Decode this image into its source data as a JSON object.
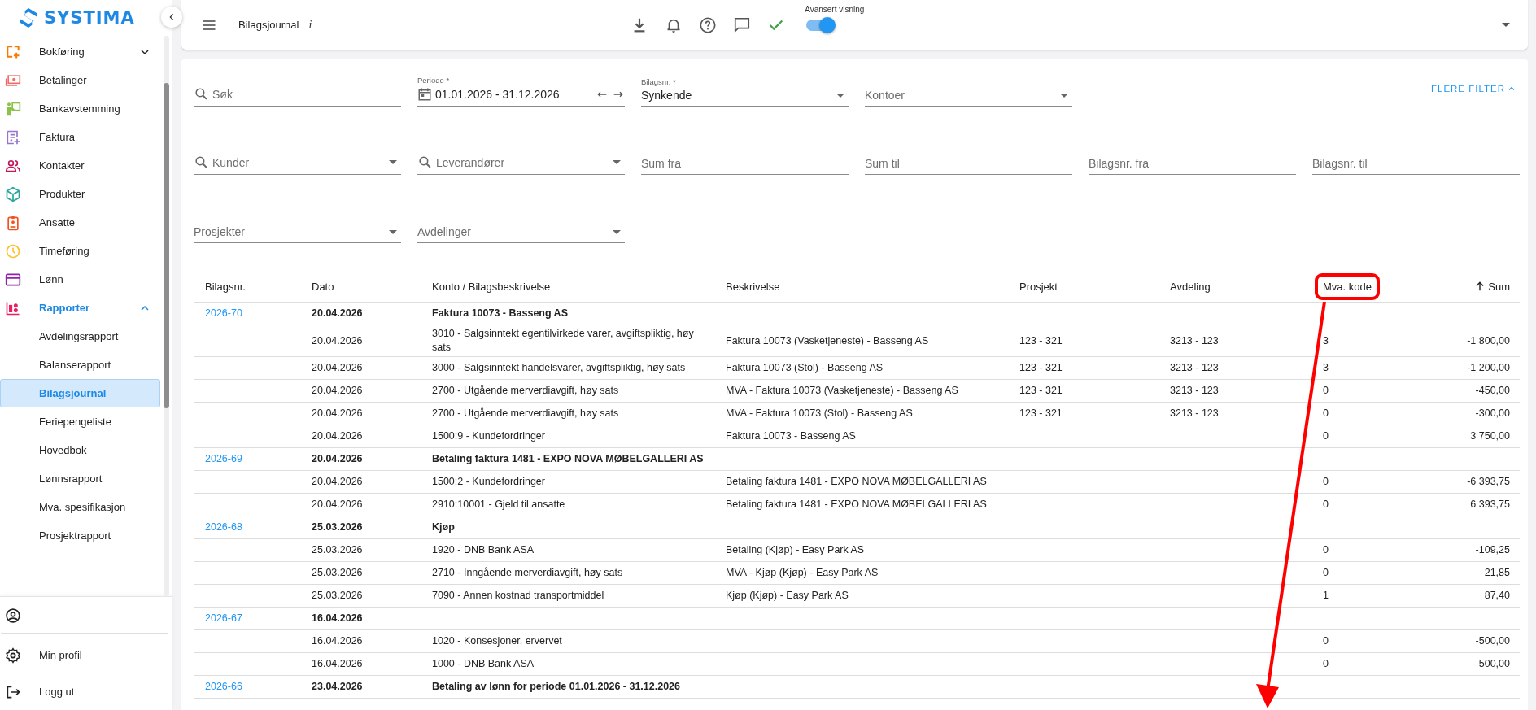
{
  "brand": {
    "name": "SYSTIMA"
  },
  "sidebar": {
    "items": [
      {
        "label": "Bokføring",
        "expanded": false
      },
      {
        "label": "Betalinger"
      },
      {
        "label": "Bankavstemming"
      },
      {
        "label": "Faktura"
      },
      {
        "label": "Kontakter"
      },
      {
        "label": "Produkter"
      },
      {
        "label": "Ansatte"
      },
      {
        "label": "Timeføring"
      },
      {
        "label": "Lønn"
      },
      {
        "label": "Rapporter",
        "expanded": true,
        "children": [
          {
            "label": "Avdelingsrapport",
            "selected": false
          },
          {
            "label": "Balanserapport",
            "selected": false
          },
          {
            "label": "Bilagsjournal",
            "selected": true
          },
          {
            "label": "Feriepengeliste",
            "selected": false
          },
          {
            "label": "Hovedbok",
            "selected": false
          },
          {
            "label": "Lønnsrapport",
            "selected": false
          },
          {
            "label": "Mva. spesifikasjon",
            "selected": false
          },
          {
            "label": "Prosjektrapport",
            "selected": false
          }
        ]
      }
    ],
    "footer": [
      {
        "kind": "account"
      },
      {
        "kind": "settings",
        "label": "Min profil"
      },
      {
        "kind": "logout",
        "label": "Logg ut"
      }
    ]
  },
  "topbar": {
    "title": "Bilagsjournal",
    "info_mark": "i",
    "toggle": {
      "label": "Avansert visning",
      "on": true
    }
  },
  "filters": {
    "rows": [
      [
        {
          "kind": "search",
          "placeholder": "Søk"
        },
        {
          "kind": "date",
          "label": "Periode *",
          "value": "01.01.2026 - 31.12.2026"
        },
        {
          "kind": "select",
          "label": "Bilagsnr. *",
          "value": "Synkende"
        },
        {
          "kind": "select",
          "placeholder": "Kontoer"
        }
      ],
      [
        {
          "kind": "search-select",
          "placeholder": "Kunder"
        },
        {
          "kind": "search-select",
          "placeholder": "Leverandører"
        },
        {
          "kind": "text",
          "placeholder": "Sum fra"
        },
        {
          "kind": "text",
          "placeholder": "Sum til"
        },
        {
          "kind": "text",
          "placeholder": "Bilagsnr. fra"
        },
        {
          "kind": "text",
          "placeholder": "Bilagsnr. til"
        }
      ],
      [
        {
          "kind": "select",
          "placeholder": "Prosjekter"
        },
        {
          "kind": "select",
          "placeholder": "Avdelinger"
        }
      ]
    ],
    "more": {
      "label": "FLERE FILTER",
      "expanded": true
    }
  },
  "table": {
    "columns": [
      {
        "label": "Bilagsnr."
      },
      {
        "label": "Dato"
      },
      {
        "label": "Konto / Bilagsbeskrivelse"
      },
      {
        "label": "Beskrivelse"
      },
      {
        "label": "Prosjekt"
      },
      {
        "label": "Avdeling"
      },
      {
        "label": "Mva. kode",
        "highlighted": true
      },
      {
        "label": "Sum",
        "sorted_ascending": true
      }
    ],
    "rows": [
      {
        "kind": "voucher",
        "number": "2026-70",
        "date": "20.04.2026",
        "description": "Faktura 10073 - Basseng AS"
      },
      {
        "kind": "line",
        "date": "20.04.2026",
        "account": "3010 - Salgsinntekt egentilvirkede varer, avgiftspliktig, høy sats",
        "description": "Faktura 10073 (Vasketjeneste) - Basseng AS",
        "project": "123 - 321",
        "department": "3213 - 123",
        "vat_code": "3",
        "sum": "-1 800,00"
      },
      {
        "kind": "line",
        "date": "20.04.2026",
        "account": "3000 - Salgsinntekt handelsvarer, avgiftspliktig, høy sats",
        "description": "Faktura 10073 (Stol) - Basseng AS",
        "project": "123 - 321",
        "department": "3213 - 123",
        "vat_code": "3",
        "sum": "-1 200,00"
      },
      {
        "kind": "line",
        "date": "20.04.2026",
        "account": "2700 - Utgående merverdiavgift, høy sats",
        "description": "MVA - Faktura 10073 (Vasketjeneste) - Basseng AS",
        "project": "123 - 321",
        "department": "3213 - 123",
        "vat_code": "0",
        "sum": "-450,00"
      },
      {
        "kind": "line",
        "date": "20.04.2026",
        "account": "2700 - Utgående merverdiavgift, høy sats",
        "description": "MVA - Faktura 10073 (Stol) - Basseng AS",
        "project": "123 - 321",
        "department": "3213 - 123",
        "vat_code": "0",
        "sum": "-300,00"
      },
      {
        "kind": "line",
        "date": "20.04.2026",
        "account": "1500:9 - Kundefordringer",
        "description": "Faktura 10073 - Basseng AS",
        "vat_code": "0",
        "sum": "3 750,00"
      },
      {
        "kind": "voucher",
        "number": "2026-69",
        "date": "20.04.2026",
        "description": "Betaling faktura 1481 - EXPO NOVA MØBELGALLERI AS"
      },
      {
        "kind": "line",
        "date": "20.04.2026",
        "account": "1500:2 - Kundefordringer",
        "description": "Betaling faktura 1481 - EXPO NOVA MØBELGALLERI AS",
        "vat_code": "0",
        "sum": "-6 393,75"
      },
      {
        "kind": "line",
        "date": "20.04.2026",
        "account": "2910:10001 - Gjeld til ansatte",
        "description": "Betaling faktura 1481 - EXPO NOVA MØBELGALLERI AS",
        "vat_code": "0",
        "sum": "6 393,75"
      },
      {
        "kind": "voucher",
        "number": "2026-68",
        "date": "25.03.2026",
        "description": "Kjøp"
      },
      {
        "kind": "line",
        "date": "25.03.2026",
        "account": "1920 - DNB Bank ASA",
        "description": "Betaling (Kjøp) - Easy Park AS",
        "vat_code": "0",
        "sum": "-109,25"
      },
      {
        "kind": "line",
        "date": "25.03.2026",
        "account": "2710 - Inngående merverdiavgift, høy sats",
        "description": "MVA - Kjøp (Kjøp) - Easy Park AS",
        "vat_code": "0",
        "sum": "21,85"
      },
      {
        "kind": "line",
        "date": "25.03.2026",
        "account": "7090 - Annen kostnad transportmiddel",
        "description": "Kjøp (Kjøp) - Easy Park AS",
        "vat_code": "1",
        "sum": "87,40"
      },
      {
        "kind": "voucher",
        "number": "2026-67",
        "date": "16.04.2026"
      },
      {
        "kind": "line",
        "date": "16.04.2026",
        "account": "1020 - Konsesjoner, ervervet",
        "vat_code": "0",
        "sum": "-500,00"
      },
      {
        "kind": "line",
        "date": "16.04.2026",
        "account": "1000 - DNB Bank ASA",
        "vat_code": "0",
        "sum": "500,00"
      },
      {
        "kind": "voucher",
        "number": "2026-66",
        "date": "23.04.2026",
        "description": "Betaling av lønn for periode 01.01.2026 - 31.12.2026"
      }
    ]
  }
}
